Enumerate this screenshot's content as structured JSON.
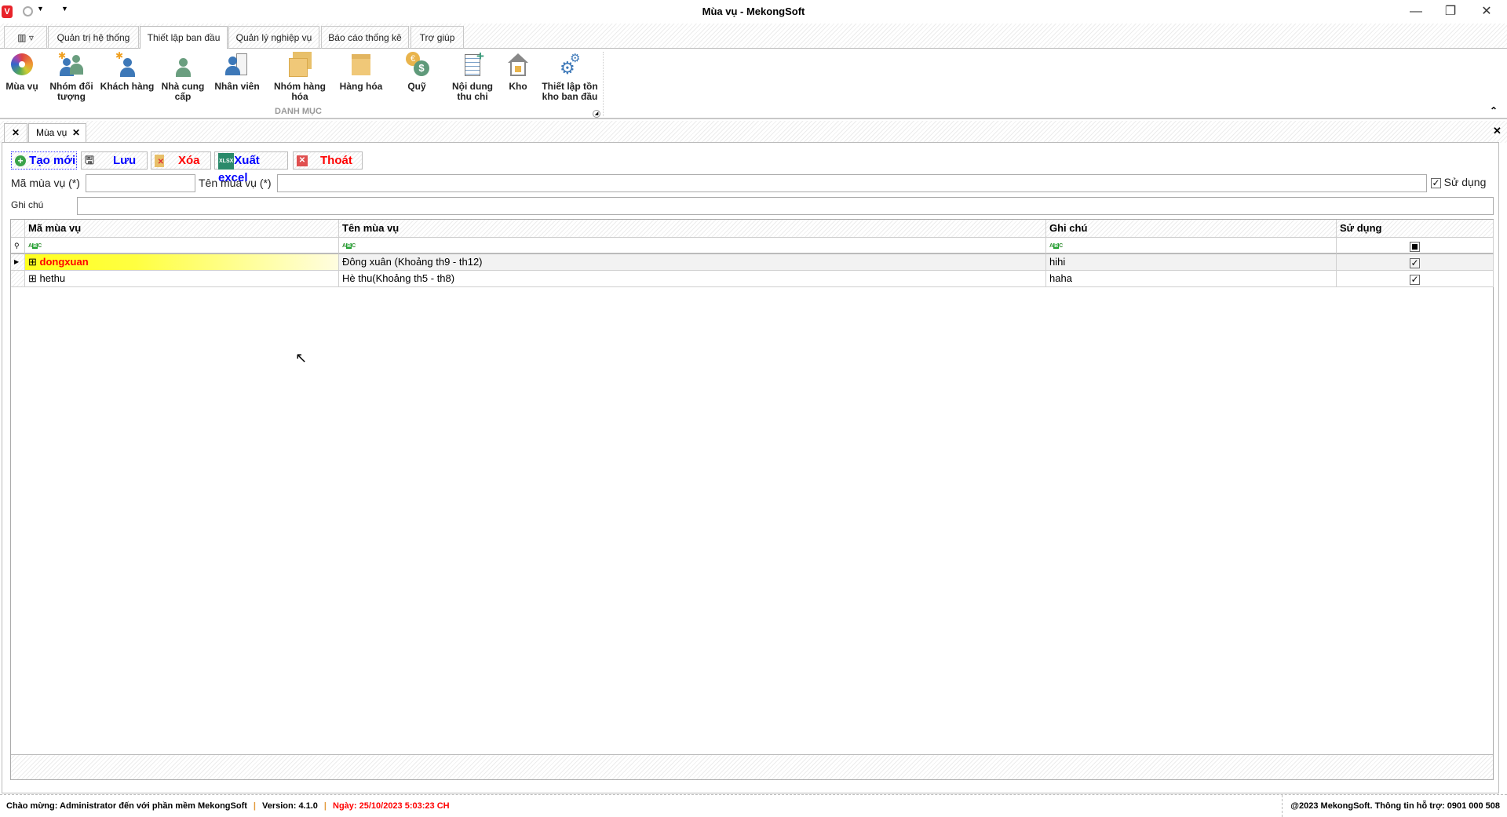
{
  "window": {
    "title": "Mùa vụ - MekongSoft",
    "minimize": "—",
    "restore": "❐",
    "close": "✕"
  },
  "ribbon_tabs": [
    "Quản trị hệ thống",
    "Thiết lập ban đầu",
    "Quản lý nghiệp vụ",
    "Báo cáo thống kê",
    "Trợ giúp"
  ],
  "ribbon": {
    "group_label": "DANH MỤC",
    "items": [
      {
        "label": "Mùa vụ",
        "icon": "disc-icon"
      },
      {
        "label": "Nhóm đối tượng",
        "icon": "user-group-icon"
      },
      {
        "label": "Khách hàng",
        "icon": "customer-icon"
      },
      {
        "label": "Nhà cung cấp",
        "icon": "supplier-icon"
      },
      {
        "label": "Nhân viên",
        "icon": "employee-icon"
      },
      {
        "label": "Nhóm hàng hóa",
        "icon": "boxes-icon"
      },
      {
        "label": "Hàng hóa",
        "icon": "box-icon"
      },
      {
        "label": "Quỹ",
        "icon": "coins-icon"
      },
      {
        "label": "Nội dung thu chi",
        "icon": "document-add-icon"
      },
      {
        "label": "Kho",
        "icon": "warehouse-icon"
      },
      {
        "label": "Thiết lập tồn kho ban đầu",
        "icon": "gears-icon"
      }
    ]
  },
  "doc_tabs": {
    "active": "Mùa vụ"
  },
  "toolbar": {
    "new": "Tạo mới",
    "save": "Lưu",
    "delete": "Xóa",
    "export": "Xuất excel",
    "exit": "Thoát"
  },
  "form": {
    "code_label": "Mã mùa vụ (*)",
    "code_value": "",
    "name_label": "Tên mùa vụ (*)",
    "name_value": "",
    "active_label": "Sử dụng",
    "active_checked": true,
    "note_label": "Ghi chú",
    "note_value": ""
  },
  "grid": {
    "columns": [
      "Mã mùa vụ",
      "Tên mùa vụ",
      "Ghi chú",
      "Sử dụng"
    ],
    "rows": [
      {
        "code": "dongxuan",
        "name": "Đông xuân (Khoảng th9 - th12)",
        "note": "hihi",
        "active": true,
        "selected": true
      },
      {
        "code": "hethu",
        "name": "Hè thu(Khoảng th5 - th8)",
        "note": "haha",
        "active": true,
        "selected": false
      }
    ]
  },
  "status": {
    "welcome": "Chào mừng: Administrator đến với phần mềm MekongSoft",
    "version": "Version: 4.1.0",
    "date": "Ngày: 25/10/2023 5:03:23 CH",
    "support": "@2023 MekongSoft. Thông tin hỗ trợ: 0901 000 508"
  },
  "colors": {
    "accent_red": "#ff0000",
    "selected_row": "#ffff33",
    "button_blue": "#0000ff"
  }
}
